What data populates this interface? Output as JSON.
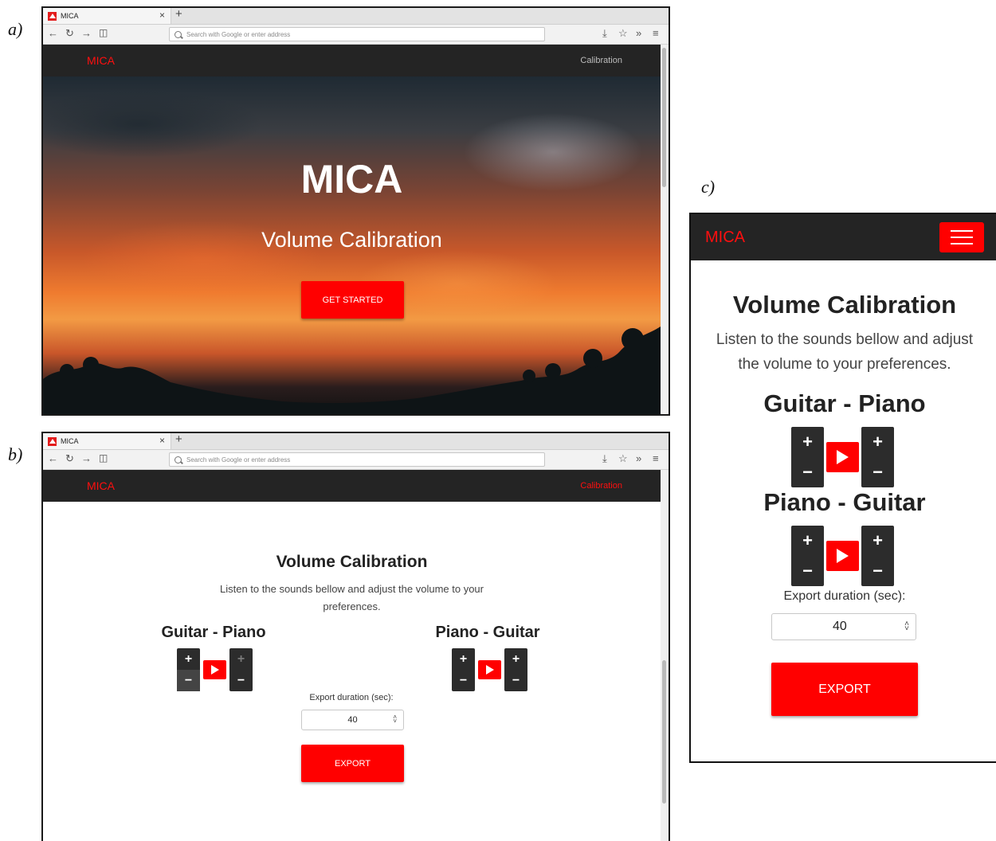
{
  "panel_labels": {
    "a": "a)",
    "b": "b)",
    "c": "c)"
  },
  "browser": {
    "tab_title": "MICA",
    "tab_close": "×",
    "new_tab": "+",
    "url_placeholder": "Search with Google or enter address",
    "icons": [
      "back-icon",
      "reload-icon",
      "forward-icon",
      "sidebar-icon",
      "download-icon",
      "bookmarks-icon",
      "overflow-icon",
      "menu-icon"
    ]
  },
  "site": {
    "brand": "MICA",
    "nav_link": "Calibration",
    "brand_color": "#ff0f0f",
    "accent_color": "#ff0000",
    "navbar_color": "#242424"
  },
  "hero": {
    "title": "MICA",
    "subtitle": "Volume Calibration",
    "cta": "GET STARTED"
  },
  "calibration": {
    "title": "Volume Calibration",
    "description": "Listen to the sounds bellow and adjust the volume to your preferences.",
    "desktop_description_lines": [
      "Listen to the sounds bellow and adjust the volume to your",
      "preferences."
    ],
    "mobile_description_lines": [
      "Listen to the sounds bellow and adjust",
      "the volume to your preferences."
    ],
    "pairs": [
      {
        "name": "Guitar - Piano"
      },
      {
        "name": "Piano - Guitar"
      }
    ],
    "plus": "+",
    "minus": "−",
    "export_label": "Export duration (sec):",
    "export_value": "40",
    "export_button": "EXPORT",
    "spinner_up": "˄",
    "spinner_down": "˅"
  }
}
